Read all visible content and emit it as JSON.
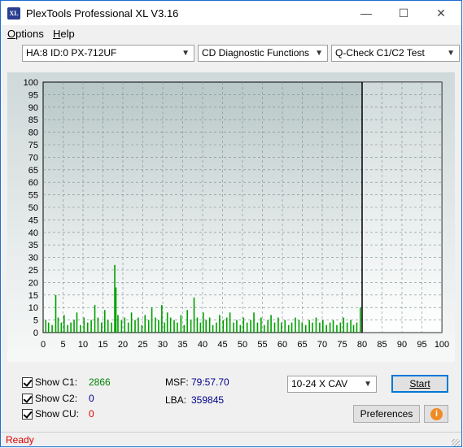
{
  "window": {
    "title": "PlexTools Professional XL V3.16",
    "icon_text": "XL"
  },
  "menu": [
    {
      "u": "O",
      "rest": "ptions"
    },
    {
      "u": "H",
      "rest": "elp"
    }
  ],
  "toolbar": {
    "drive": "HA:8 ID:0  PX-712UF",
    "function": "CD Diagnostic Functions",
    "test": "Q-Check C1/C2 Test"
  },
  "chart_data": {
    "type": "bar",
    "xlabel": "",
    "ylabel": "",
    "xlim": [
      0,
      100
    ],
    "ylim": [
      0,
      100
    ],
    "x_ticks": [
      0,
      5,
      10,
      15,
      20,
      25,
      30,
      35,
      40,
      45,
      50,
      55,
      60,
      65,
      70,
      75,
      80,
      85,
      90,
      95,
      100
    ],
    "y_ticks": [
      0,
      5,
      10,
      15,
      20,
      25,
      30,
      35,
      40,
      45,
      50,
      55,
      60,
      65,
      70,
      75,
      80,
      85,
      90,
      95,
      100
    ],
    "grid": true,
    "end_marker_x": 80,
    "colors": {
      "c1": "#00a000",
      "background_top": "#b8c7c7",
      "background_bottom": "#ffffff"
    },
    "series": [
      {
        "name": "C1",
        "x": [
          0.5,
          1.2,
          2.1,
          3.0,
          3.6,
          4.4,
          5.1,
          6.0,
          6.8,
          7.6,
          8.3,
          9.2,
          10.1,
          11.0,
          11.9,
          12.8,
          13.6,
          14.5,
          15.3,
          16.1,
          17.0,
          17.8,
          18.1,
          18.6,
          19.5,
          20.3,
          21.2,
          22.0,
          22.9,
          23.7,
          24.6,
          25.4,
          26.3,
          27.1,
          28.0,
          28.8,
          29.6,
          30.3,
          31.0,
          31.8,
          32.7,
          33.5,
          34.4,
          35.2,
          36.0,
          36.9,
          37.7,
          38.5,
          39.3,
          40.0,
          40.7,
          41.6,
          42.4,
          43.3,
          44.1,
          45.0,
          45.9,
          46.7,
          47.6,
          48.4,
          49.3,
          50.1,
          51.0,
          51.9,
          52.7,
          53.6,
          54.5,
          55.3,
          56.2,
          57.0,
          57.9,
          58.8,
          59.6,
          60.5,
          61.4,
          62.2,
          63.1,
          64.0,
          64.8,
          65.7,
          66.6,
          67.4,
          68.3,
          69.2,
          70.0,
          70.9,
          71.8,
          72.6,
          73.5,
          74.4,
          75.2,
          76.1,
          77.0,
          77.7,
          78.5,
          79.4
        ],
        "values": [
          5,
          4,
          3,
          15,
          6,
          4,
          7,
          3,
          4,
          5,
          8,
          3,
          6,
          4,
          5,
          11,
          6,
          4,
          9,
          5,
          4,
          27,
          18,
          7,
          5,
          6,
          4,
          8,
          5,
          6,
          3,
          7,
          5,
          10,
          6,
          5,
          11,
          4,
          8,
          6,
          5,
          4,
          7,
          3,
          9,
          5,
          14,
          6,
          4,
          8,
          5,
          6,
          3,
          4,
          7,
          5,
          6,
          8,
          4,
          5,
          3,
          6,
          4,
          5,
          8,
          4,
          6,
          3,
          5,
          7,
          4,
          6,
          4,
          5,
          3,
          4,
          6,
          5,
          4,
          3,
          5,
          4,
          6,
          4,
          5,
          3,
          4,
          5,
          3,
          4,
          6,
          4,
          5,
          3,
          4,
          10
        ]
      }
    ]
  },
  "stats": {
    "c1_label": "Show C1:",
    "c1_value": "2866",
    "c2_label": "Show C2:",
    "c2_value": "0",
    "cu_label": "Show CU:",
    "cu_value": "0",
    "msf_label": "MSF:",
    "msf_value": "79:57.70",
    "lba_label": "LBA:",
    "lba_value": "359845"
  },
  "speed_select": "10-24 X CAV",
  "buttons": {
    "start": "Start",
    "preferences": "Preferences",
    "info": "i"
  },
  "status": "Ready"
}
